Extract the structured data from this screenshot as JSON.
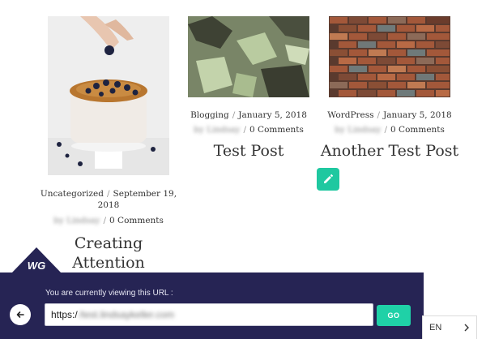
{
  "posts": [
    {
      "category": "Uncategorized",
      "date": "September 19, 2018",
      "author": "by Lindsay",
      "comments": "0 Comments",
      "title": "Creating Attention",
      "image": "cake-photo"
    },
    {
      "category": "Blogging",
      "date": "January 5, 2018",
      "author": "by Lindsay",
      "comments": "0 Comments",
      "title": "Test Post",
      "image": "grunge-texture"
    },
    {
      "category": "WordPress",
      "date": "January 5, 2018",
      "author": "by Lindsay",
      "comments": "0 Comments",
      "title": "Another Test Post",
      "image": "brick-wall"
    }
  ],
  "separator": "/",
  "edit_icon": "pencil-icon",
  "badge": {
    "text": "WG",
    "color": "#262454"
  },
  "url_bar": {
    "label": "You are currently viewing this URL :",
    "url_prefix": "https:/",
    "url_rest": "/test.lindsaykeller.com",
    "go_label": "GO",
    "back_icon": "arrow-left-icon"
  },
  "language": {
    "code": "EN",
    "icon": "chevron-right-icon"
  },
  "colors": {
    "accent": "#1fd1a7",
    "bar": "#262454"
  }
}
